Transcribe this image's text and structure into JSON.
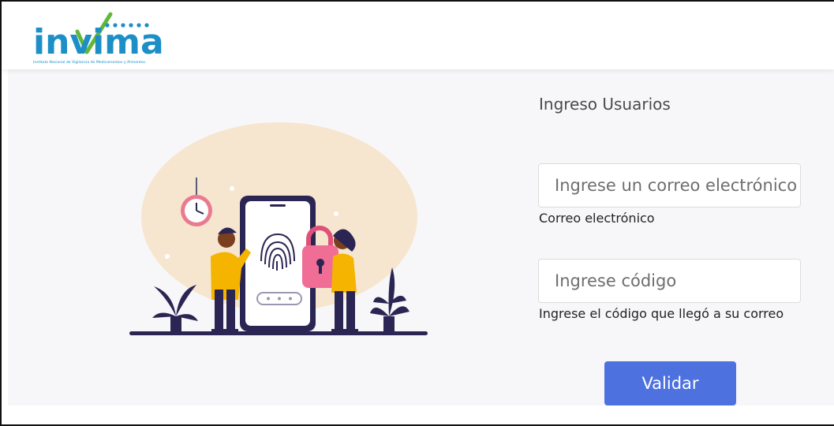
{
  "brand": {
    "name": "invima",
    "tagline": "Instituto Nacional de Vigilancia de Medicamentos y Alimentos.",
    "colors": {
      "primary": "#1d8fc7",
      "accent": "#62b73a"
    }
  },
  "login": {
    "title": "Ingreso Usuarios",
    "email": {
      "placeholder": "Ingrese un correo electrónico",
      "help": "Correo electrónico"
    },
    "code": {
      "placeholder": "Ingrese código",
      "help": "Ingrese el código que llegó a su correo"
    },
    "submit_label": "Validar",
    "accent_color": "#4d72e0"
  },
  "illustration": {
    "icons": [
      "wall-clock-icon",
      "fingerprint-icon",
      "padlock-icon",
      "password-dots-icon",
      "potted-plant-icon"
    ]
  }
}
